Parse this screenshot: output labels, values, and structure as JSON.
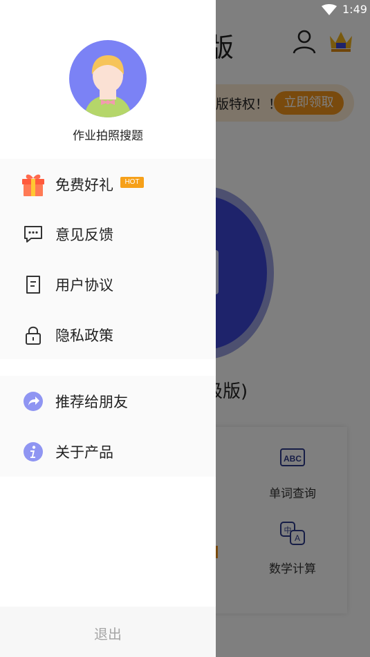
{
  "status_bar": {
    "time": "1:49"
  },
  "background": {
    "title": "版",
    "promo_text": "版特权！！",
    "promo_button": "立即领取",
    "heading": "级版)",
    "tiles": [
      {
        "label": "单词查询",
        "icon": "abc-icon"
      },
      {
        "label": "数学计算",
        "icon": "translate-icon"
      }
    ],
    "colors": {
      "accent": "#3c46d6",
      "orange": "#f3951a"
    }
  },
  "drawer": {
    "profile": {
      "app_name": "作业拍照搜题",
      "avatar_color": "#7b82f5"
    },
    "menu_group_1": [
      {
        "label": "免费好礼",
        "icon": "gift-icon",
        "badge": "HOT"
      },
      {
        "label": "意见反馈",
        "icon": "chat-feedback-icon"
      },
      {
        "label": "用户协议",
        "icon": "document-icon"
      },
      {
        "label": "隐私政策",
        "icon": "lock-icon"
      }
    ],
    "menu_group_2": [
      {
        "label": "推荐给朋友",
        "icon": "share-icon"
      },
      {
        "label": "关于产品",
        "icon": "info-icon"
      }
    ],
    "logout": "退出"
  }
}
